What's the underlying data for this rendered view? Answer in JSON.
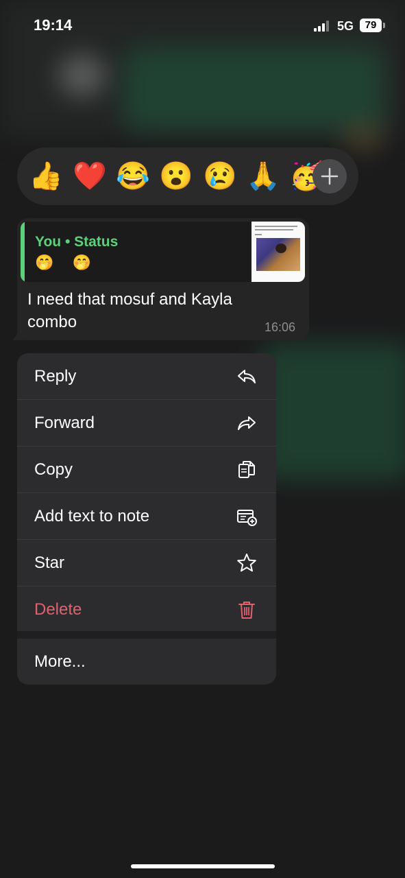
{
  "status_bar": {
    "time": "19:14",
    "network": "5G",
    "battery": "79"
  },
  "reactions": {
    "emojis": [
      "👍",
      "❤️",
      "😂",
      "😮",
      "😢",
      "🙏",
      "🥳"
    ],
    "more_label": "+"
  },
  "message": {
    "quote_author": "You • Status",
    "quote_text": "🤭 🤭",
    "text": "I need that mosuf and Kayla combo",
    "time": "16:06"
  },
  "menu": {
    "items": [
      {
        "label": "Reply",
        "icon": "reply-icon"
      },
      {
        "label": "Forward",
        "icon": "forward-icon"
      },
      {
        "label": "Copy",
        "icon": "copy-icon"
      },
      {
        "label": "Add text to note",
        "icon": "note-add-icon"
      },
      {
        "label": "Star",
        "icon": "star-icon"
      },
      {
        "label": "Delete",
        "icon": "trash-icon"
      }
    ],
    "more": "More..."
  },
  "colors": {
    "accent_green": "#5fd07a",
    "danger": "#e0626e",
    "menu_bg": "#2c2c2e"
  }
}
